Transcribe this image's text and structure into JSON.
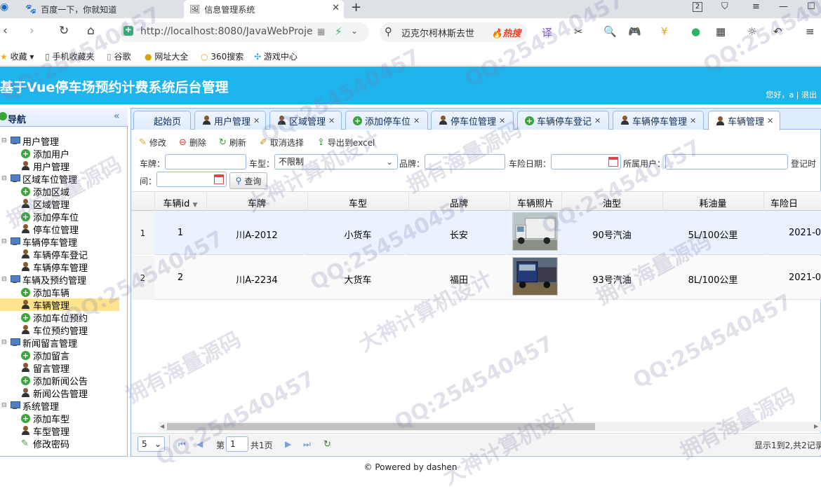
{
  "browser": {
    "tabs": [
      {
        "title": "百度一下，你就知道"
      },
      {
        "title": "信息管理系统"
      }
    ],
    "tab_count": "2",
    "url": "http://localhost:8080/JavaWebProje",
    "search_text": "迈克尔柯林斯去世",
    "hot_label": "热搜",
    "bookmarks": [
      "收藏",
      "手机收藏夹",
      "谷歌",
      "网址大全",
      "360搜索",
      "游戏中心"
    ]
  },
  "app": {
    "title": "基于Vue停车场预约计费系统后台管理",
    "user_greeting": "您好，a | 退出"
  },
  "sidebar": {
    "title": "导航",
    "groups": [
      {
        "label": "用户管理",
        "items": [
          "添加用户",
          "用户管理"
        ]
      },
      {
        "label": "区域车位管理",
        "items": [
          "添加区域",
          "区域管理",
          "添加停车位",
          "停车位管理"
        ]
      },
      {
        "label": "车辆停车管理",
        "items": [
          "车辆停车登记",
          "车辆停车管理"
        ]
      },
      {
        "label": "车辆及预约管理",
        "items": [
          "添加车辆",
          "车辆管理",
          "添加车位预约",
          "车位预约管理"
        ]
      },
      {
        "label": "新闻留言管理",
        "items": [
          "添加留言",
          "留言管理",
          "添加新闻公告",
          "新闻公告管理"
        ]
      },
      {
        "label": "系统管理",
        "items": [
          "添加车型",
          "车型管理",
          "修改密码"
        ]
      }
    ],
    "selected": "车辆管理"
  },
  "content_tabs": [
    "起始页",
    "用户管理",
    "区域管理",
    "添加停车位",
    "停车位管理",
    "车辆停车登记",
    "车辆停车管理",
    "车辆管理"
  ],
  "toolbar": {
    "edit": "修改",
    "delete": "删除",
    "refresh": "刷新",
    "cancel": "取消选择",
    "export": "导出到excel"
  },
  "filters": {
    "plate_label": "车牌：",
    "type_label": "车型：",
    "type_value": "不限制",
    "brand_label": "品牌：",
    "insurance_label": "车险日期：",
    "owner_label": "所属用户：",
    "regtime_label_a": "登记时",
    "regtime_label_b": "间：",
    "query_label": "查询"
  },
  "grid": {
    "columns": [
      "车辆id",
      "车牌",
      "车型",
      "品牌",
      "车辆照片",
      "油型",
      "耗油量",
      "车险日"
    ],
    "rows": [
      {
        "num": "1",
        "id": "1",
        "plate": "川A-2012",
        "type": "小货车",
        "brand": "长安",
        "fuel": "90号汽油",
        "consumption": "5L/100公里",
        "insurance": "2021-0"
      },
      {
        "num": "2",
        "id": "2",
        "plate": "川A-2234",
        "type": "大货车",
        "brand": "福田",
        "fuel": "93号汽油",
        "consumption": "8L/100公里",
        "insurance": "2021-0"
      }
    ]
  },
  "pager": {
    "page_size": "5",
    "page_prefix": "第",
    "page_value": "1",
    "page_total": "共1页",
    "summary": "显示1到2,共2记录"
  },
  "footer": "© Powered by dashen",
  "watermarks": [
    "QQ:254540457",
    "拥有海量源码",
    "大神计算机设计"
  ]
}
